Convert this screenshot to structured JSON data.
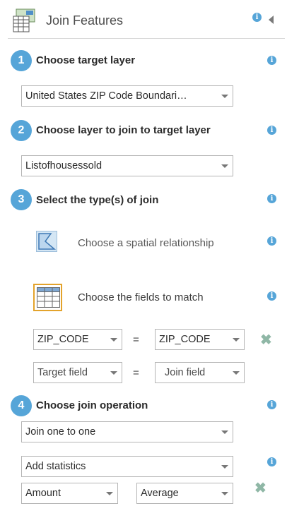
{
  "header": {
    "title": "Join Features"
  },
  "steps": [
    {
      "number": "1",
      "title": "Choose target layer",
      "select_value": "United States ZIP Code Boundari…"
    },
    {
      "number": "2",
      "title": "Choose layer to join to target layer",
      "select_value": "Listofhousessold"
    },
    {
      "number": "3",
      "title": "Select the type(s) of join",
      "options": {
        "spatial_label": "Choose a spatial relationship",
        "fields_label": "Choose the fields to match"
      },
      "field_rows": [
        {
          "target": "ZIP_CODE",
          "operator": "=",
          "join": "ZIP_CODE"
        },
        {
          "target": "Target field",
          "operator": "=",
          "join": "Join field"
        }
      ]
    },
    {
      "number": "4",
      "title": "Choose join operation",
      "operation_value": "Join one to one",
      "statistics_value": "Add statistics",
      "stat_row": {
        "field": "Amount",
        "statistic": "Average"
      }
    }
  ],
  "icons": {
    "info": "i",
    "remove": "✖"
  },
  "colors": {
    "step_accent": "#56a5d8",
    "selected_outline": "#e3a32c",
    "remove_icon": "#8fb7a6"
  }
}
